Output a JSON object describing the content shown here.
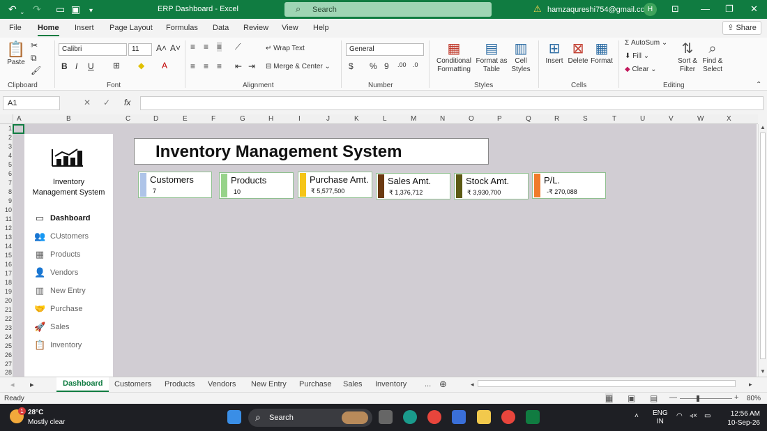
{
  "titlebar": {
    "title": "ERP Dashboard  -  Excel",
    "search_placeholder": "Search",
    "account_email": "hamzaqureshi754@gmail.com",
    "avatar_initial": "H"
  },
  "menu": {
    "tabs": [
      "File",
      "Home",
      "Insert",
      "Page Layout",
      "Formulas",
      "Data",
      "Review",
      "View",
      "Help"
    ],
    "active": "Home",
    "share_label": "Share"
  },
  "ribbon": {
    "clipboard": {
      "paste": "Paste",
      "label": "Clipboard"
    },
    "font": {
      "name": "Calibri",
      "size": "11",
      "label": "Font"
    },
    "alignment": {
      "wrap_text": "Wrap Text",
      "merge_center": "Merge & Center",
      "label": "Alignment"
    },
    "number": {
      "format": "General",
      "label": "Number"
    },
    "styles": {
      "conditional": "Conditional Formatting",
      "format_as_table": "Format as Table",
      "cell_styles": "Cell Styles",
      "label": "Styles"
    },
    "cells": {
      "insert": "Insert",
      "delete": "Delete",
      "format": "Format",
      "label": "Cells"
    },
    "editing": {
      "autosum": "AutoSum",
      "fill": "Fill",
      "clear": "Clear",
      "sort_filter": "Sort & Filter",
      "find_select": "Find & Select",
      "label": "Editing"
    }
  },
  "formula_bar": {
    "name_box": "A1",
    "formula": ""
  },
  "columns": [
    "A",
    "B",
    "C",
    "D",
    "E",
    "F",
    "G",
    "H",
    "I",
    "J",
    "K",
    "L",
    "M",
    "N",
    "O",
    "P",
    "Q",
    "R",
    "S",
    "T",
    "U",
    "V",
    "W",
    "X"
  ],
  "rows": [
    "1",
    "2",
    "3",
    "4",
    "5",
    "6",
    "7",
    "8",
    "9",
    "10",
    "11",
    "12",
    "13",
    "14",
    "15",
    "16",
    "17",
    "18",
    "19",
    "20",
    "21",
    "22",
    "23",
    "24",
    "25",
    "26",
    "27",
    "28"
  ],
  "dashboard": {
    "app_title_line1": "Inventory",
    "app_title_line2": "Management System",
    "heading": "Inventory Management System",
    "nav": [
      {
        "label": "Dashboard",
        "icon": "presentation-icon",
        "active": true
      },
      {
        "label": "CUstomers",
        "icon": "users-icon",
        "active": false
      },
      {
        "label": "Products",
        "icon": "box-icon",
        "active": false
      },
      {
        "label": "Vendors",
        "icon": "person-icon",
        "active": false
      },
      {
        "label": "New Entry",
        "icon": "bar-chart-icon",
        "active": false
      },
      {
        "label": "Purchase",
        "icon": "handshake-icon",
        "active": false
      },
      {
        "label": "Sales",
        "icon": "rocket-icon",
        "active": false
      },
      {
        "label": "Inventory",
        "icon": "clipboard-icon",
        "active": false
      }
    ],
    "kpis": [
      {
        "label": "Customers",
        "value": "7",
        "color": "#aec4e8"
      },
      {
        "label": "Products",
        "value": "10",
        "color": "#97d38a"
      },
      {
        "label": "Purchase Amt.",
        "value": "₹ 5,577,500",
        "color": "#f5c518"
      },
      {
        "label": "Sales Amt.",
        "value": "₹ 1,376,712",
        "color": "#6b3a12"
      },
      {
        "label": "Stock Amt.",
        "value": "₹ 3,930,700",
        "color": "#5c5a14"
      },
      {
        "label": "P/L.",
        "value": "-₹ 270,088",
        "color": "#f07b2a"
      }
    ]
  },
  "sheet_tabs": [
    "Dashboard",
    "Customers",
    "Products",
    "Vendors",
    "New Entry",
    "Purchase",
    "Sales",
    "Inventory"
  ],
  "sheet_tabs_more": "...",
  "status": {
    "ready": "Ready",
    "zoom": "80%"
  },
  "taskbar": {
    "temperature": "28°C",
    "condition": "Mostly clear",
    "search": "Search",
    "lang_line1": "ENG",
    "lang_line2": "IN",
    "time": "12:56 AM",
    "date": "10-Sep-26",
    "notification_count": "1"
  }
}
